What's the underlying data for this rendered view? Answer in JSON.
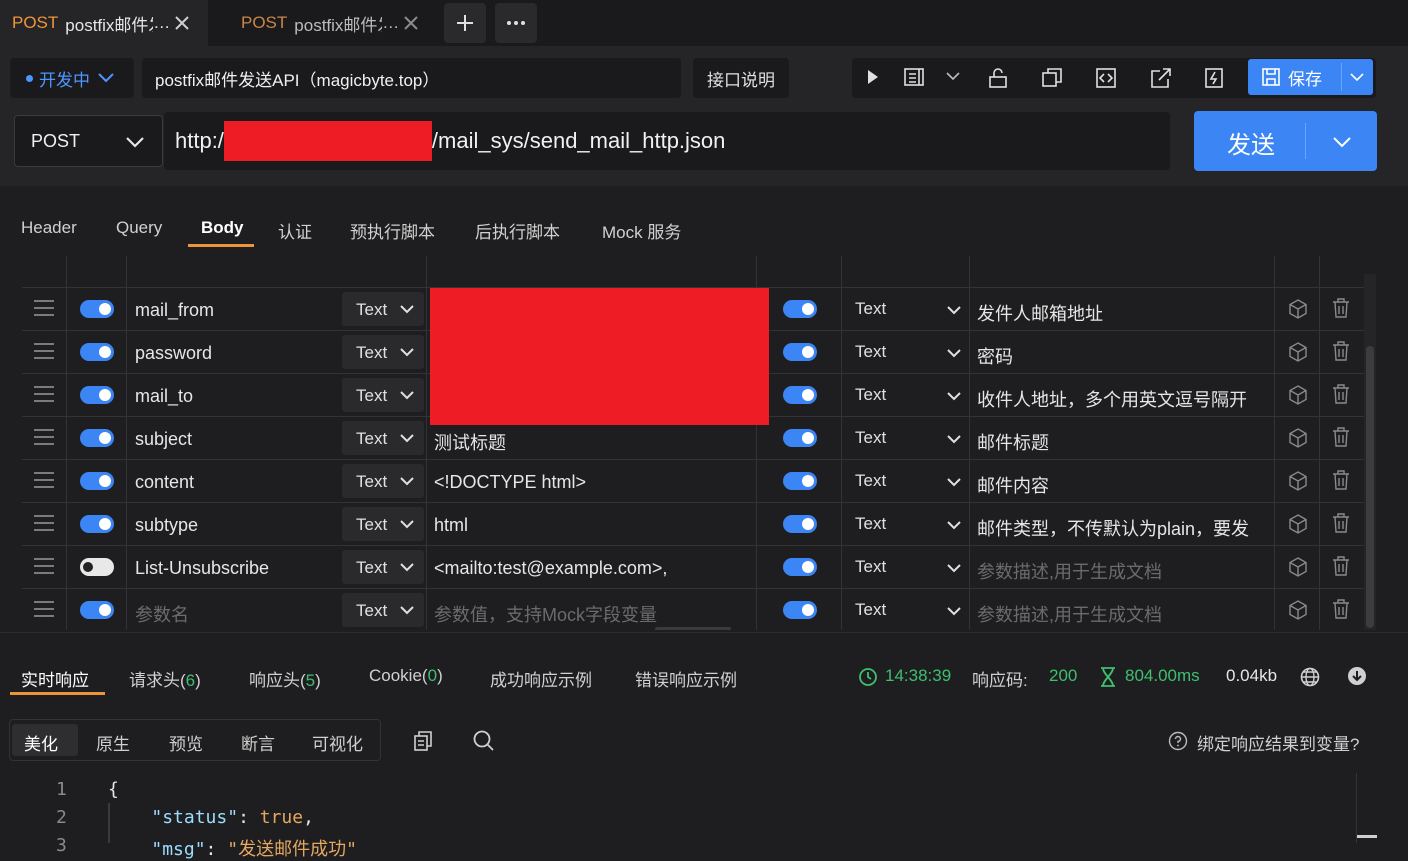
{
  "tabs": [
    {
      "method": "POST",
      "title": "postfix邮件发送API（magicbyte.top）"
    },
    {
      "method": "POST",
      "title": "postfix邮件发送API（magicbyte.top）"
    }
  ],
  "header": {
    "status": "开发中",
    "api_name": "postfix邮件发送API（magicbyte.top）",
    "doc_button": "接口说明",
    "save_button": "保存"
  },
  "request": {
    "method": "POST",
    "url_prefix": "http:/",
    "url_suffix": "/mail_sys/send_mail_http.json",
    "send_button": "发送"
  },
  "subtabs": [
    "Header",
    "Query",
    "Body",
    "认证",
    "预执行脚本",
    "后执行脚本",
    "Mock 服务"
  ],
  "params": [
    {
      "name": "mail_from",
      "type": "Text",
      "value": "",
      "ptype": "Text",
      "desc": "发件人邮箱地址",
      "enabled": true
    },
    {
      "name": "password",
      "type": "Text",
      "value": "",
      "ptype": "Text",
      "desc": "密码",
      "enabled": true
    },
    {
      "name": "mail_to",
      "type": "Text",
      "value": "",
      "ptype": "Text",
      "desc": "收件人地址，多个用英文逗号隔开",
      "enabled": true
    },
    {
      "name": "subject",
      "type": "Text",
      "value": "测试标题",
      "ptype": "Text",
      "desc": "邮件标题",
      "enabled": true
    },
    {
      "name": "content",
      "type": "Text",
      "value": "<!DOCTYPE html>",
      "ptype": "Text",
      "desc": "邮件内容",
      "enabled": true
    },
    {
      "name": "subtype",
      "type": "Text",
      "value": "html",
      "ptype": "Text",
      "desc": "邮件类型，不传默认为plain，要发",
      "enabled": true
    },
    {
      "name": "List-Unsubscribe",
      "type": "Text",
      "value": " <mailto:test@example.com>,",
      "ptype": "Text",
      "desc": "",
      "enabled": false
    },
    {
      "name": "",
      "type": "Text",
      "value": "",
      "ptype": "Text",
      "desc": "",
      "enabled": true
    }
  ],
  "placeholders": {
    "name": "参数名",
    "value": "参数值，支持Mock字段变量",
    "desc": "参数描述,用于生成文档"
  },
  "response": {
    "tabs": {
      "realtime": "实时响应",
      "req_headers": "请求头",
      "req_headers_count": "6",
      "resp_headers": "响应头",
      "resp_headers_count": "5",
      "cookie": "Cookie",
      "cookie_count": "0",
      "success_example": "成功响应示例",
      "error_example": "错误响应示例"
    },
    "time": "14:38:39",
    "code_label": "响应码:",
    "code": "200",
    "duration": "804.00ms",
    "size": "0.04kb",
    "views": [
      "美化",
      "原生",
      "预览",
      "断言",
      "可视化"
    ],
    "bind_label": "绑定响应结果到变量?",
    "lines": [
      {
        "n": "1",
        "text": "{"
      },
      {
        "n": "2",
        "key": "\"status\"",
        "val": "true"
      },
      {
        "n": "3",
        "key": "\"msg\"",
        "val": "\"发送邮件成功\""
      }
    ]
  },
  "colors": {
    "accent": "#3b85f4",
    "method": "#f0943a",
    "success": "#3fbf6f",
    "redaction": "#ee1c25"
  }
}
